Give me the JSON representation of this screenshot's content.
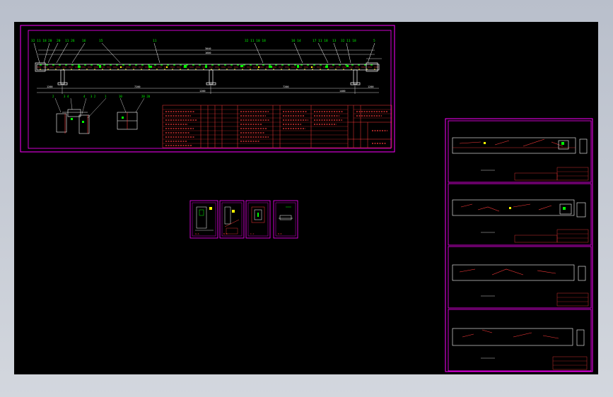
{
  "colors": {
    "background": "#000000",
    "sheet_border": "#ff00ff",
    "text_lines": "#ff3b3b",
    "parts": "#ffffff",
    "annotation": "#00ff00",
    "highlight": "#ffff00",
    "viewport_frame": "#c6cbd5"
  },
  "main_sheet": {
    "balloon_labels": [
      "32 11 18",
      "20",
      "20",
      "11 26",
      "16",
      "15",
      "11",
      "32 11 10 18",
      "16 14",
      "17 11 18",
      "13",
      "32 11 18",
      "5"
    ],
    "dim_top": [
      "3040",
      "1600"
    ],
    "dim_bottom": [
      "1200",
      "7200",
      "1200",
      "7200",
      "1400",
      "1200"
    ],
    "section_labels": [
      "2",
      "3 4",
      "4",
      "3 2",
      "1",
      "10",
      "20 20"
    ]
  },
  "sheets_grid": {
    "thumbnails": [
      "A-A",
      "B-B",
      "C-C",
      "D-D"
    ]
  },
  "right_sheets": {
    "count": 4
  }
}
